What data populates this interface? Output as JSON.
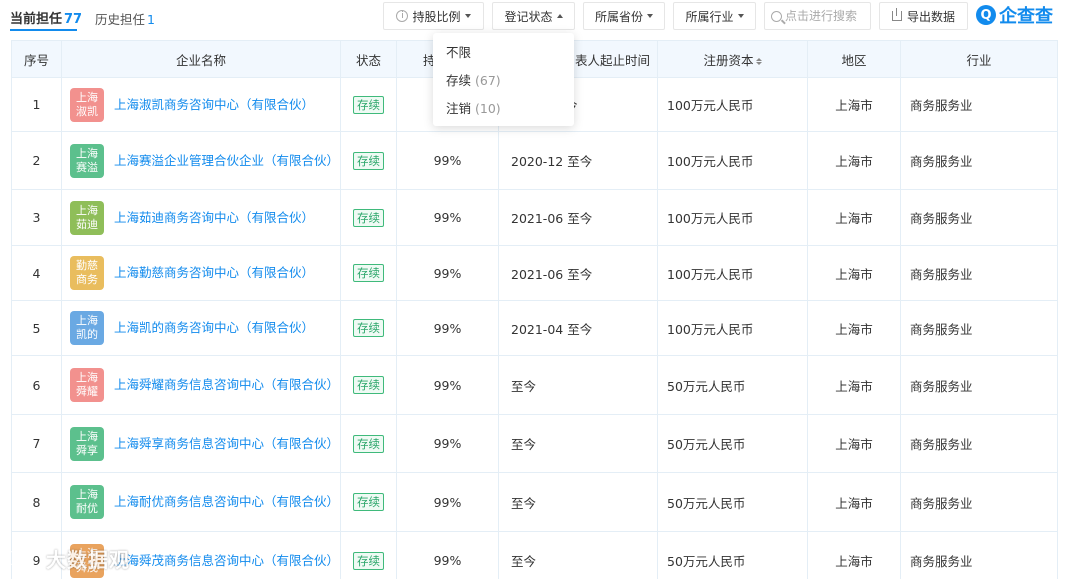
{
  "tabs": {
    "current_label": "当前担任",
    "current_count": "77",
    "history_label": "历史担任",
    "history_count": "1"
  },
  "filters": {
    "share_ratio": "持股比例",
    "reg_status": "登记状态",
    "province": "所属省份",
    "industry": "所属行业"
  },
  "search": {
    "placeholder": "点击进行搜索"
  },
  "export_label": "导出数据",
  "logo_text": "企查查",
  "logo_mark": "Q",
  "dropdown": {
    "items": [
      {
        "label": "不限",
        "count": ""
      },
      {
        "label": "存续",
        "count": "(67)"
      },
      {
        "label": "注销",
        "count": "(10)"
      }
    ]
  },
  "table": {
    "headers": {
      "idx": "序号",
      "name": "企业名称",
      "status": "状态",
      "share": "持",
      "period": "表人起止时间",
      "capital": "注册资本",
      "region": "地区",
      "industry": "行业"
    },
    "rows": [
      {
        "idx": "1",
        "av1": "上海",
        "av2": "淑凯",
        "color": "#f2918e",
        "name": "上海淑凯商务咨询中心（有限合伙）",
        "status": "存续",
        "share": "",
        "period": "今",
        "capital": "100万元人民币",
        "region": "上海市",
        "industry": "商务服务业"
      },
      {
        "idx": "2",
        "av1": "上海",
        "av2": "赛溢",
        "color": "#5cc08d",
        "name": "上海赛溢企业管理合伙企业（有限合伙）",
        "status": "存续",
        "share": "99%",
        "period": "2020-12 至今",
        "capital": "100万元人民币",
        "region": "上海市",
        "industry": "商务服务业"
      },
      {
        "idx": "3",
        "av1": "上海",
        "av2": "茹迪",
        "color": "#8fbe59",
        "name": "上海茹迪商务咨询中心（有限合伙）",
        "status": "存续",
        "share": "99%",
        "period": "2021-06 至今",
        "capital": "100万元人民币",
        "region": "上海市",
        "industry": "商务服务业"
      },
      {
        "idx": "4",
        "av1": "勤慈",
        "av2": "商务",
        "color": "#e9bd5e",
        "name": "上海勤慈商务咨询中心（有限合伙）",
        "status": "存续",
        "share": "99%",
        "period": "2021-06 至今",
        "capital": "100万元人民币",
        "region": "上海市",
        "industry": "商务服务业"
      },
      {
        "idx": "5",
        "av1": "上海",
        "av2": "凯的",
        "color": "#6aa9e3",
        "name": "上海凯的商务咨询中心（有限合伙）",
        "status": "存续",
        "share": "99%",
        "period": "2021-04 至今",
        "capital": "100万元人民币",
        "region": "上海市",
        "industry": "商务服务业"
      },
      {
        "idx": "6",
        "av1": "上海",
        "av2": "舜耀",
        "color": "#f2918e",
        "name": "上海舜耀商务信息咨询中心（有限合伙）",
        "status": "存续",
        "share": "99%",
        "period": "至今",
        "capital": "50万元人民币",
        "region": "上海市",
        "industry": "商务服务业"
      },
      {
        "idx": "7",
        "av1": "上海",
        "av2": "舜享",
        "color": "#5cc08d",
        "name": "上海舜享商务信息咨询中心（有限合伙）",
        "status": "存续",
        "share": "99%",
        "period": "至今",
        "capital": "50万元人民币",
        "region": "上海市",
        "industry": "商务服务业"
      },
      {
        "idx": "8",
        "av1": "上海",
        "av2": "耐优",
        "color": "#5cc08d",
        "name": "上海耐优商务信息咨询中心（有限合伙）",
        "status": "存续",
        "share": "99%",
        "period": "至今",
        "capital": "50万元人民币",
        "region": "上海市",
        "industry": "商务服务业"
      },
      {
        "idx": "9",
        "av1": "上海",
        "av2": "舜茂",
        "color": "#e9a35e",
        "name": "上海舜茂商务信息咨询中心（有限合伙）",
        "status": "存续",
        "share": "99%",
        "period": "至今",
        "capital": "50万元人民币",
        "region": "上海市",
        "industry": "商务服务业"
      }
    ]
  },
  "watermark": {
    "text": "大数据观"
  },
  "colors": {
    "accent": "#128bed",
    "status_green": "#2ba66a",
    "header_bg": "#f2f8fe"
  }
}
